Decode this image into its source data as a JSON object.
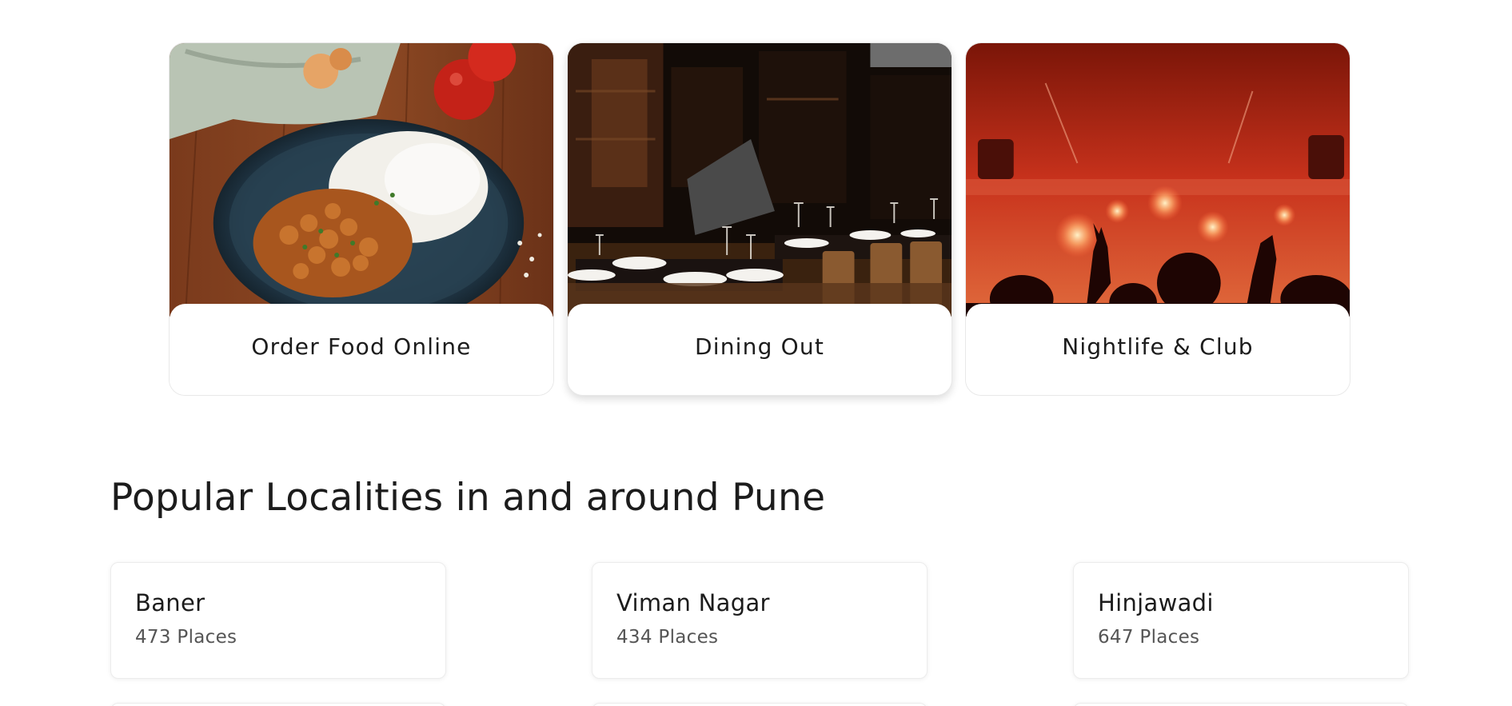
{
  "categories": [
    {
      "label": "Order Food Online",
      "image": "plate-of-chickpea-curry-and-rice"
    },
    {
      "label": "Dining Out",
      "image": "restaurant-dining-room"
    },
    {
      "label": "Nightlife & Club",
      "image": "nightclub-crowd-red-lights"
    }
  ],
  "localities_section": {
    "title": "Popular Localities in and around Pune",
    "items": [
      {
        "name": "Baner",
        "count": "473 Places"
      },
      {
        "name": "Viman Nagar",
        "count": "434 Places"
      },
      {
        "name": "Hinjawadi",
        "count": "647 Places"
      }
    ]
  },
  "colors": {
    "text": "#1c1c1c",
    "muted": "#555555",
    "border": "#e8e8e8",
    "nightlife_red": "#c8321c"
  }
}
